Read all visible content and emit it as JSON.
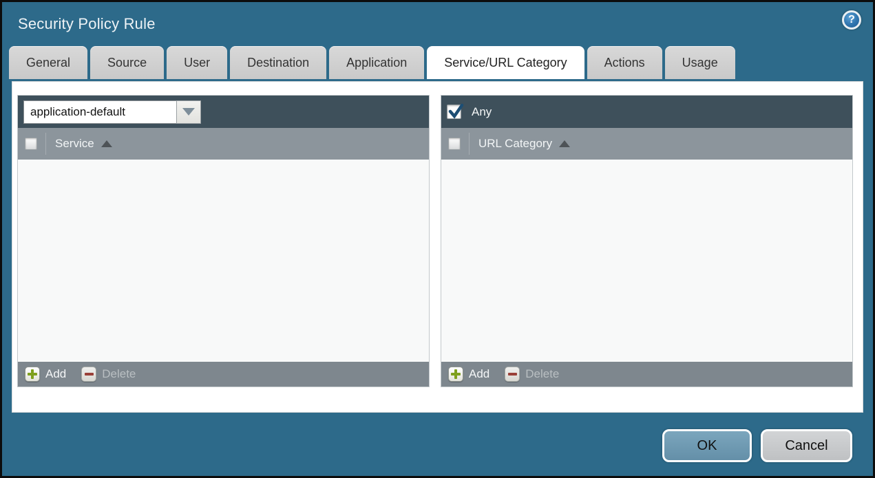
{
  "dialog": {
    "title": "Security Policy Rule",
    "help_icon_glyph": "?"
  },
  "tabs": {
    "active_index": 5,
    "items": [
      {
        "label": "General"
      },
      {
        "label": "Source"
      },
      {
        "label": "User"
      },
      {
        "label": "Destination"
      },
      {
        "label": "Application"
      },
      {
        "label": "Service/URL Category"
      },
      {
        "label": "Actions"
      },
      {
        "label": "Usage"
      }
    ]
  },
  "service_panel": {
    "dropdown_value": "application-default",
    "column_header": "Service",
    "sort_direction": "asc",
    "header_checkbox_checked": false,
    "rows": [],
    "add_label": "Add",
    "delete_label": "Delete",
    "delete_enabled": false
  },
  "url_category_panel": {
    "any_label": "Any",
    "any_checked": true,
    "column_header": "URL Category",
    "sort_direction": "asc",
    "header_checkbox_checked": false,
    "rows": [],
    "add_label": "Add",
    "delete_label": "Delete",
    "delete_enabled": false
  },
  "actions": {
    "ok_label": "OK",
    "cancel_label": "Cancel"
  },
  "colors": {
    "dialog_background": "#2d6a8a",
    "panel_toolbar": "#3e505b",
    "panel_header": "#8c959c",
    "panel_footer": "#7e878e",
    "ok_button": "#6f9cb5",
    "cancel_button": "#c8cacc",
    "add_plus_green": "#7fa01e",
    "delete_minus_red": "#9a4038",
    "checkmark_navy": "#1d4e74",
    "active_tab": "#ffffff",
    "inactive_tab": "#cccccc"
  }
}
